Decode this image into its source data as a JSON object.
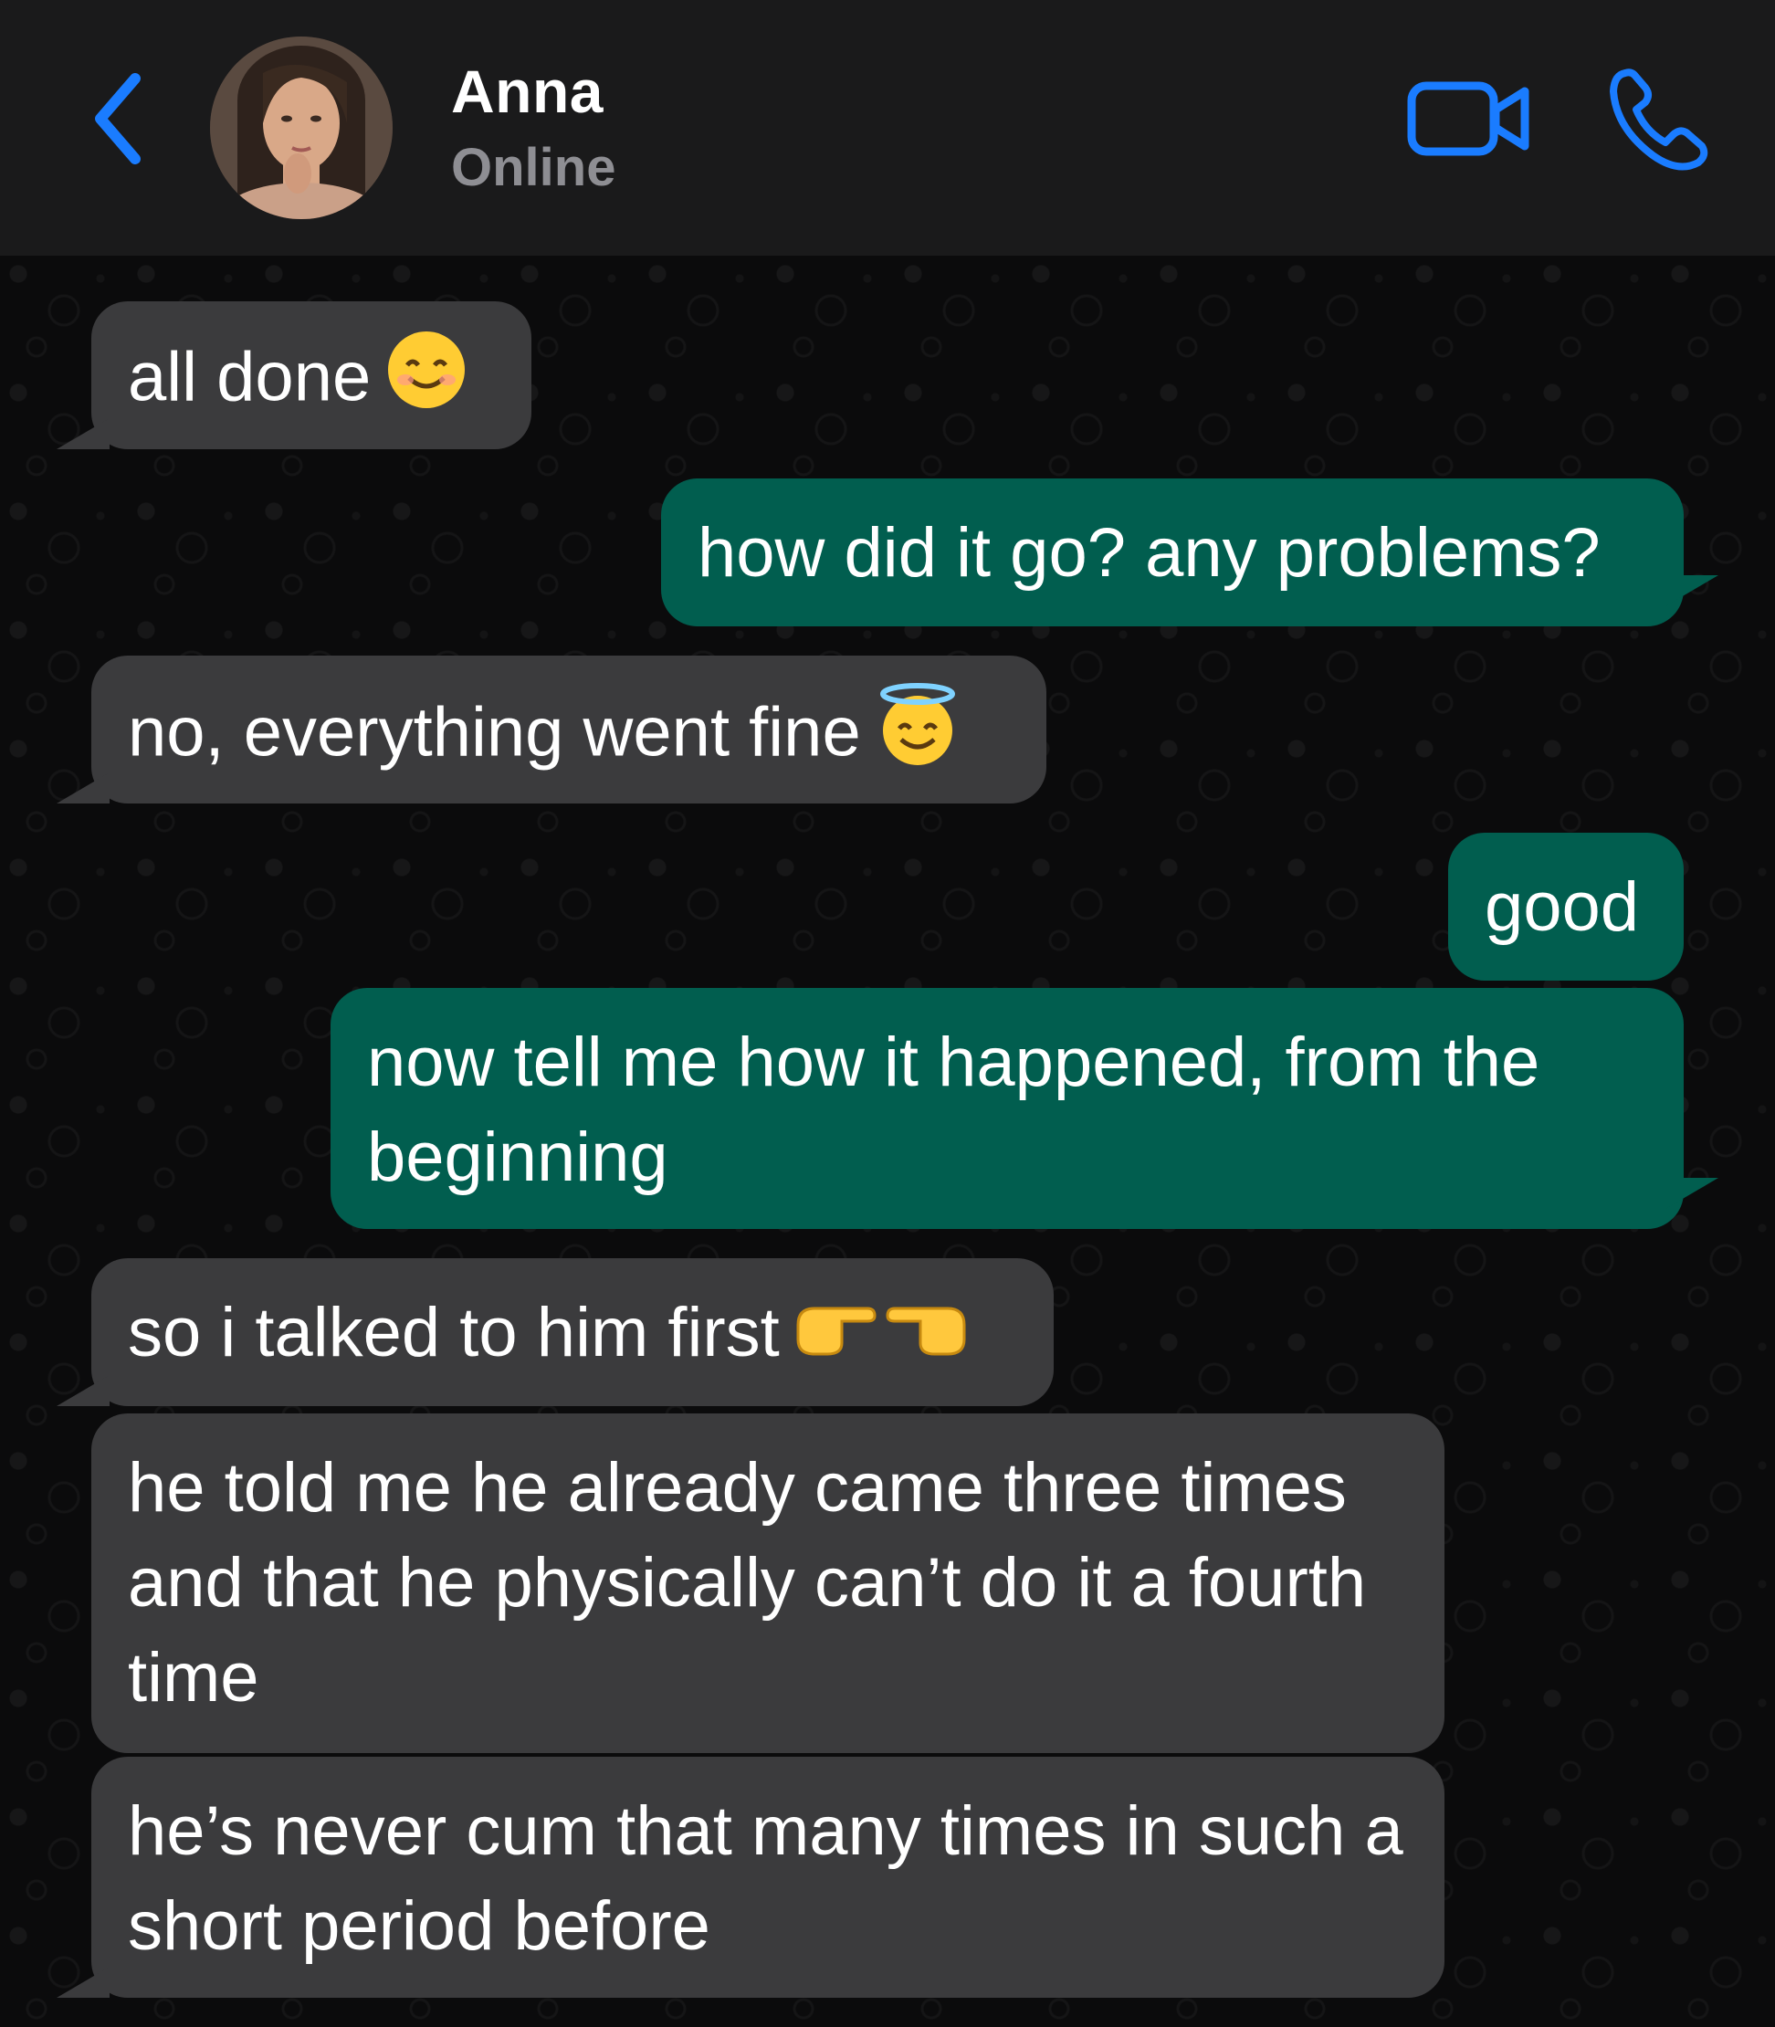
{
  "header": {
    "contact_name": "Anna",
    "status": "Online",
    "accent_color": "#1a7cff",
    "icons": [
      "back-chevron-icon",
      "video-camera-icon",
      "phone-icon"
    ]
  },
  "messages": [
    {
      "direction": "incoming",
      "text": "all done",
      "emoji": "smiling-face-icon"
    },
    {
      "direction": "outgoing",
      "text": "how did it go? any problems?"
    },
    {
      "direction": "incoming",
      "text": "no, everything went fine",
      "emoji": "halo-face-icon"
    },
    {
      "direction": "outgoing",
      "text": "good"
    },
    {
      "direction": "outgoing",
      "text": "now tell me how it happened, from the beginning"
    },
    {
      "direction": "incoming",
      "text": "so i talked to him first",
      "emoji": "pointing-hands-icon"
    },
    {
      "direction": "incoming",
      "text": "he told me he already came three times and that he physically can’t do it a fourth time"
    },
    {
      "direction": "incoming",
      "text": "he’s never cum that many times in such a short period before"
    }
  ],
  "colors": {
    "incoming_bubble": "#3b3b3d",
    "outgoing_bubble": "#015e4f",
    "header_bg": "#1a1a1b",
    "chat_bg": "#0b0b0c"
  }
}
